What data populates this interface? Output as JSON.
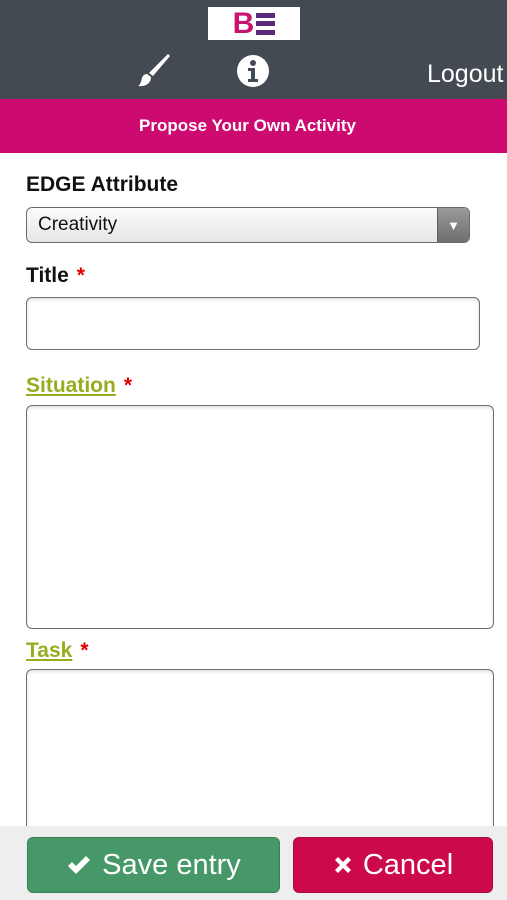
{
  "header": {
    "logout_label": "Logout",
    "icons": [
      "brush-icon",
      "info-icon"
    ],
    "colors": {
      "topbar": "#444a52",
      "logo_pink": "#c8136f",
      "logo_purple": "#5a2b7a"
    }
  },
  "page": {
    "title": "Propose Your Own Activity",
    "accent_color": "#cc0a6f"
  },
  "form": {
    "edge_attribute": {
      "label": "EDGE Attribute",
      "value": "Creativity"
    },
    "title": {
      "label": "Title",
      "required_mark": "*",
      "value": ""
    },
    "situation": {
      "label": "Situation",
      "required_mark": "*",
      "value": "",
      "link_color": "#98ac1f"
    },
    "task": {
      "label": "Task",
      "required_mark": "*",
      "value": ""
    }
  },
  "footer": {
    "save_label": "Save entry",
    "cancel_label": "Cancel",
    "save_color": "#479869",
    "cancel_color": "#cc0a49"
  }
}
